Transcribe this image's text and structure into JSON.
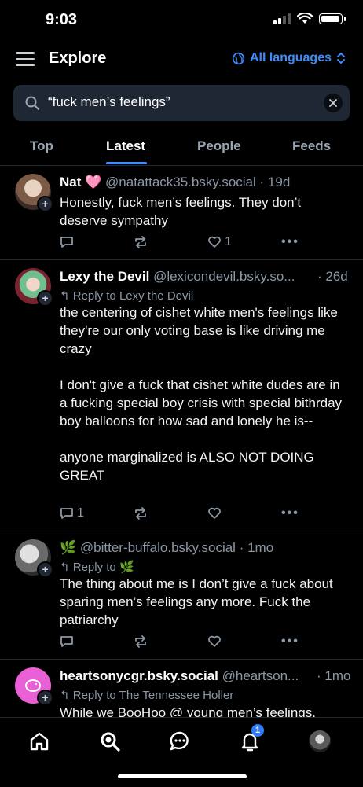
{
  "status_bar": {
    "time": "9:03"
  },
  "header": {
    "title": "Explore",
    "language_label": "All languages"
  },
  "search": {
    "query": "“fuck men’s feelings”"
  },
  "tabs": [
    {
      "label": "Top",
      "active": false
    },
    {
      "label": "Latest",
      "active": true
    },
    {
      "label": "People",
      "active": false
    },
    {
      "label": "Feeds",
      "active": false
    }
  ],
  "posts": [
    {
      "name": "Nat 🩷",
      "handle": "@natattack35.bsky.social",
      "time": "· 19d",
      "reply_to": "",
      "body": "Honestly, fuck men’s feelings. They don’t deserve sympathy",
      "reply_count": "",
      "like_count": "1"
    },
    {
      "name": "Lexy the Devil",
      "handle": "@lexicondevil.bsky.so...",
      "time": "· 26d",
      "reply_to": "Reply to Lexy the Devil",
      "body": "the centering of cishet white men's feelings like they're our only voting base is like driving me crazy\n\nI don't give a fuck that cishet white dudes are in a fucking special boy crisis with special bithrday boy balloons for how sad and lonely he is--\n\nanyone marginalized is ALSO NOT DOING GREAT",
      "reply_count": "1",
      "like_count": ""
    },
    {
      "name": "🌿",
      "handle": "@bitter-buffalo.bsky.social",
      "time": "· 1mo",
      "reply_to": "Reply to 🌿",
      "body": "The thing about me is I don’t give a fuck about sparing men’s feelings any more. Fuck the patriarchy",
      "reply_count": "",
      "like_count": ""
    },
    {
      "name": "heartsonycgr.bsky.social",
      "handle": "@heartson...",
      "time": "· 1mo",
      "reply_to": "Reply to The Tennessee Holler",
      "body": "While we BooHoo @ young men’s feelings,",
      "reply_count": "",
      "like_count": ""
    }
  ],
  "bottom_nav": {
    "notifications_badge": "1"
  },
  "colors": {
    "accent": "#3e8cf7",
    "background": "#000000",
    "muted": "#8b98a5"
  }
}
